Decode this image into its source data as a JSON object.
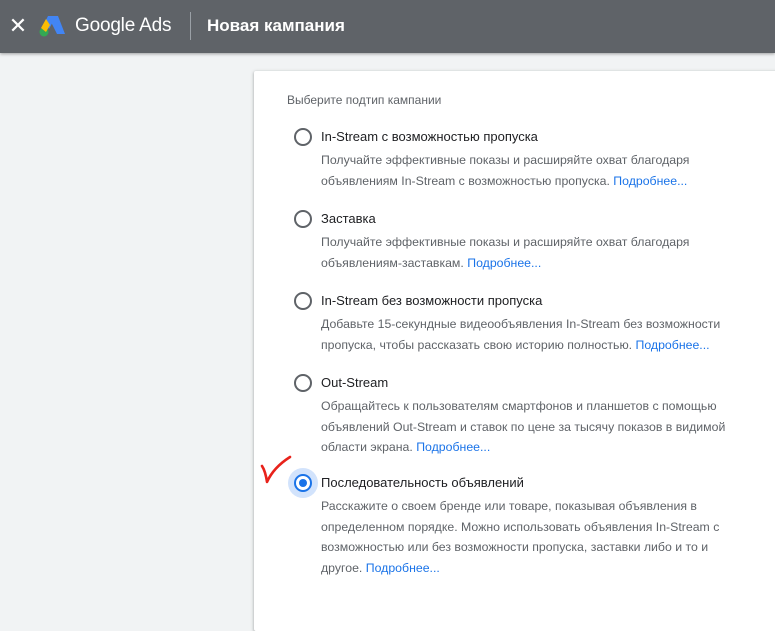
{
  "header": {
    "close_icon": "close-icon",
    "logo_icon": "google-ads-logo-icon",
    "brand": "Google Ads",
    "title": "Новая кампания",
    "background_color": "#5f6368"
  },
  "main": {
    "section_label": "Выберите подтип кампании",
    "learn_more_label": "Подробнее...",
    "options": [
      {
        "title": "In-Stream с возможностью пропуска",
        "selected": false,
        "desc_lines": [
          "Получайте эффективные показы и расширяйте охват благодаря",
          "объявлениям In-Stream с возможностью пропуска."
        ],
        "learn_more": "Подробнее..."
      },
      {
        "title": "Заставка",
        "selected": false,
        "desc_lines": [
          "Получайте эффективные показы и расширяйте охват благодаря",
          "объявлениям-заставкам."
        ],
        "learn_more": "Подробнее..."
      },
      {
        "title": "In-Stream без возможности пропуска",
        "selected": false,
        "desc_lines": [
          "Добавьте 15-секундные видеообъявления In-Stream без возможности",
          "пропуска, чтобы рассказать свою историю полностью."
        ],
        "learn_more": "Подробнее..."
      },
      {
        "title": "Out-Stream",
        "selected": false,
        "desc_lines": [
          "Обращайтесь к пользователям смартфонов и планшетов с помощью",
          "объявлений Out-Stream и ставок по цене за тысячу показов в видимой",
          "области экрана."
        ],
        "learn_more": "Подробнее..."
      },
      {
        "title": "Последовательность объявлений",
        "selected": true,
        "desc_lines": [
          "Расскажите о своем бренде или товаре, показывая объявления в",
          "определенном порядке. Можно использовать объявления In-Stream с",
          "возможностью или без возможности пропуска, заставки либо и то и",
          "другое."
        ],
        "learn_more": "Подробнее..."
      }
    ],
    "accent_color": "#1a73e8",
    "annotation_icon": "red-checkmark-icon"
  }
}
